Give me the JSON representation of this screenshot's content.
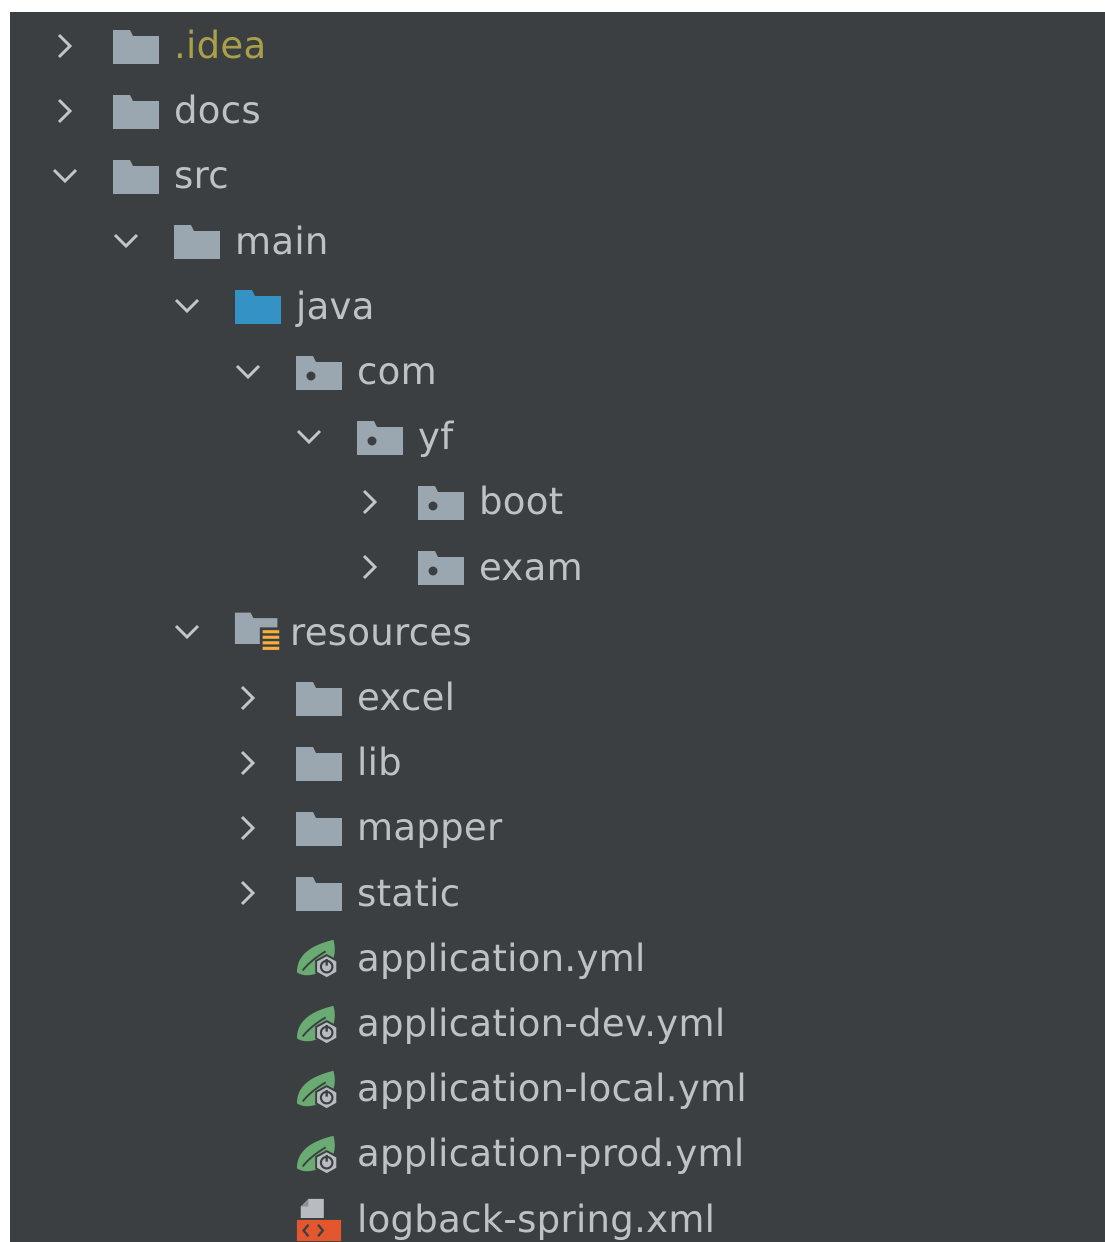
{
  "tree": [
    {
      "label": ".idea",
      "depth": 0,
      "arrow": "collapsed",
      "icon": "folder-icon",
      "state": "excluded"
    },
    {
      "label": "docs",
      "depth": 0,
      "arrow": "collapsed",
      "icon": "folder-icon",
      "state": "normal"
    },
    {
      "label": "src",
      "depth": 0,
      "arrow": "expanded",
      "icon": "folder-icon",
      "state": "normal"
    },
    {
      "label": "main",
      "depth": 1,
      "arrow": "expanded",
      "icon": "folder-icon",
      "state": "normal"
    },
    {
      "label": "java",
      "depth": 2,
      "arrow": "expanded",
      "icon": "source-root-folder-icon",
      "state": "normal"
    },
    {
      "label": "com",
      "depth": 3,
      "arrow": "expanded",
      "icon": "package-icon",
      "state": "normal"
    },
    {
      "label": "yf",
      "depth": 4,
      "arrow": "expanded",
      "icon": "package-icon",
      "state": "normal"
    },
    {
      "label": "boot",
      "depth": 5,
      "arrow": "collapsed",
      "icon": "package-icon",
      "state": "normal"
    },
    {
      "label": "exam",
      "depth": 5,
      "arrow": "collapsed",
      "icon": "package-icon",
      "state": "normal"
    },
    {
      "label": "resources",
      "depth": 2,
      "arrow": "expanded",
      "icon": "resources-root-folder-icon",
      "state": "normal"
    },
    {
      "label": "excel",
      "depth": 3,
      "arrow": "collapsed",
      "icon": "folder-icon",
      "state": "normal"
    },
    {
      "label": "lib",
      "depth": 3,
      "arrow": "collapsed",
      "icon": "folder-icon",
      "state": "normal"
    },
    {
      "label": "mapper",
      "depth": 3,
      "arrow": "collapsed",
      "icon": "folder-icon",
      "state": "normal"
    },
    {
      "label": "static",
      "depth": 3,
      "arrow": "collapsed",
      "icon": "folder-icon",
      "state": "normal"
    },
    {
      "label": "application.yml",
      "depth": 3,
      "arrow": "none",
      "icon": "spring-config-icon",
      "state": "normal"
    },
    {
      "label": "application-dev.yml",
      "depth": 3,
      "arrow": "none",
      "icon": "spring-config-icon",
      "state": "normal"
    },
    {
      "label": "application-local.yml",
      "depth": 3,
      "arrow": "none",
      "icon": "spring-config-icon",
      "state": "normal"
    },
    {
      "label": "application-prod.yml",
      "depth": 3,
      "arrow": "none",
      "icon": "spring-config-icon",
      "state": "normal"
    },
    {
      "label": "logback-spring.xml",
      "depth": 3,
      "arrow": "none",
      "icon": "xml-file-icon",
      "state": "normal"
    }
  ],
  "colors": {
    "background": "#3c3f41",
    "text": "#bfc2c5",
    "excluded_text": "#aaa04a",
    "folder": "#9aa7b0",
    "source_folder": "#3592c4",
    "resources_marker": "#f4af3d",
    "spring_green": "#6aab73",
    "xml_orange": "#e4572e"
  }
}
